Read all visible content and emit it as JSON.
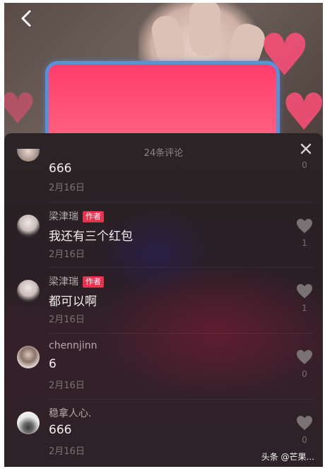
{
  "panel": {
    "title": "24条评论"
  },
  "comments": [
    {
      "name": "",
      "badge": "",
      "text": "666",
      "date": "2月16日",
      "likes": "0"
    },
    {
      "name": "梁津瑞",
      "badge": "作者",
      "text": "我还有三个红包",
      "date": "2月16日",
      "likes": "1"
    },
    {
      "name": "梁津瑞",
      "badge": "作者",
      "text": "都可以啊",
      "date": "2月16日",
      "likes": "1"
    },
    {
      "name": "chennjinn",
      "badge": "",
      "text": "6",
      "date": "2月16日",
      "likes": "0"
    },
    {
      "name": "稳拿人心.",
      "badge": "",
      "text": "666",
      "date": "2月16日",
      "likes": "0"
    }
  ],
  "watermark": "头条 @芒果...",
  "colors": {
    "accent_badge": "#e8334f",
    "phone_screen": "#ff3d6b",
    "panel_bg": "#2a1f25"
  },
  "icons": [
    "back-arrow-icon",
    "close-icon",
    "heart-icon"
  ]
}
